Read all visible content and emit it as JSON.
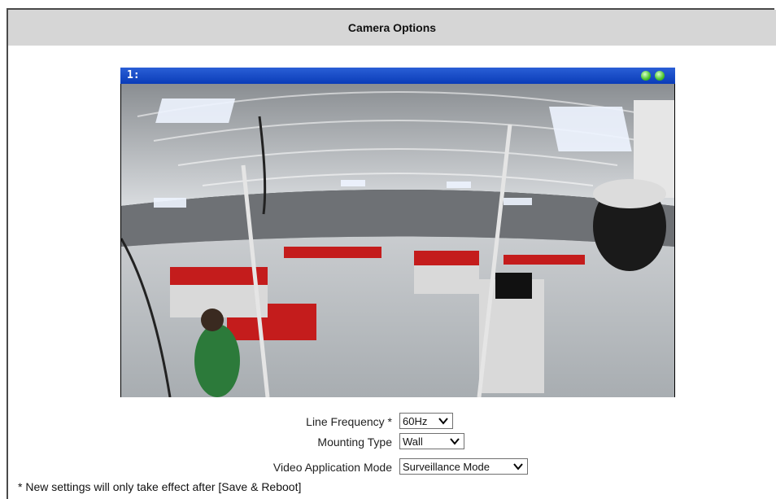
{
  "header": {
    "title": "Camera Options"
  },
  "viewer": {
    "channel_label": "1:"
  },
  "form": {
    "line_frequency": {
      "label": "Line Frequency *",
      "value": "60Hz"
    },
    "mounting_type": {
      "label": "Mounting Type",
      "value": "Wall"
    },
    "video_application_mode": {
      "label": "Video Application Mode",
      "value": "Surveillance Mode"
    }
  },
  "footer": {
    "note": "* New settings will only take effect after [Save & Reboot]"
  },
  "colors": {
    "header_bg": "#d6d6d6",
    "viewer_bar": "#0a3cb8",
    "status_led": "#49c22b"
  }
}
